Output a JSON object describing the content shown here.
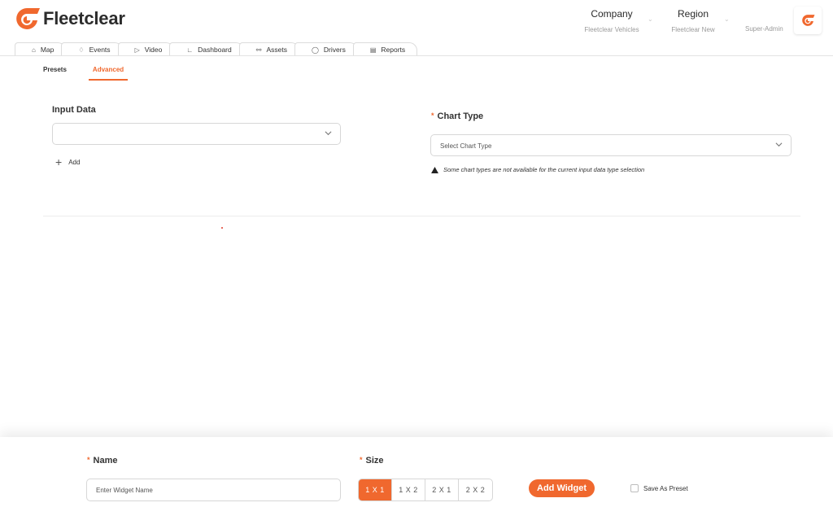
{
  "app": {
    "name": "Fleetclear",
    "brand_color": "#f0682e"
  },
  "header": {
    "company": {
      "title": "Company",
      "value": "Fleetclear Vehicles"
    },
    "region": {
      "title": "Region",
      "value": "Fleetclear New"
    },
    "role": "Super-Admin"
  },
  "nav": {
    "tabs": [
      {
        "label": "Map",
        "icon": "home-icon"
      },
      {
        "label": "Events",
        "icon": "bell-icon"
      },
      {
        "label": "Video",
        "icon": "video-icon"
      },
      {
        "label": "Dashboard",
        "icon": "chart-icon"
      },
      {
        "label": "Assets",
        "icon": "car-icon"
      },
      {
        "label": "Drivers",
        "icon": "user-icon"
      },
      {
        "label": "Reports",
        "icon": "clipboard-icon"
      }
    ]
  },
  "subtabs": {
    "presets": "Presets",
    "advanced": "Advanced",
    "active": "Advanced"
  },
  "form": {
    "input_data": {
      "label": "Input Data",
      "value": ""
    },
    "add_label": "Add",
    "chart_type": {
      "label": "Chart Type",
      "placeholder": "Select Chart Type"
    },
    "warning": "Some chart types are not available for the current input data type selection"
  },
  "footer": {
    "name": {
      "label": "Name",
      "placeholder": "Enter Widget Name"
    },
    "size": {
      "label": "Size",
      "options": [
        "1 X 1",
        "1 X 2",
        "2 X 1",
        "2 X 2"
      ],
      "selected": "1 X 1"
    },
    "add_widget": "Add Widget",
    "save_as_preset": {
      "label": "Save As Preset",
      "checked": false
    }
  }
}
